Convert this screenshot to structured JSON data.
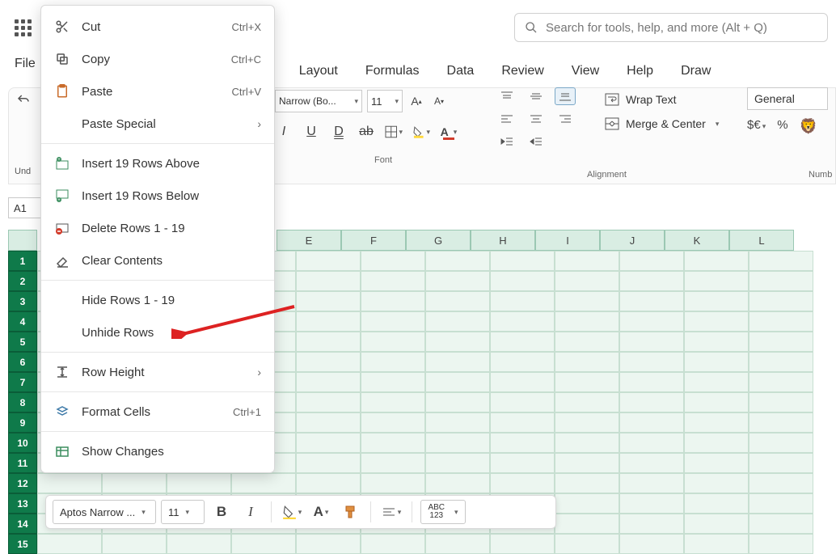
{
  "search": {
    "placeholder": "Search for tools, help, and more (Alt + Q)"
  },
  "menu_tabs": {
    "file": "File",
    "layout": "Layout",
    "formulas": "Formulas",
    "data": "Data",
    "review": "Review",
    "view": "View",
    "help": "Help",
    "draw": "Draw"
  },
  "undo_label": "Und",
  "namebox": "A1",
  "font": {
    "family": "Narrow (Bo...",
    "size": "11",
    "group_label": "Font"
  },
  "align": {
    "group_label": "Alignment"
  },
  "wrap": {
    "wrap_label": "Wrap Text",
    "merge_label": "Merge & Center"
  },
  "number": {
    "format": "General",
    "group_label": "Numb"
  },
  "columns": [
    "E",
    "F",
    "G",
    "H",
    "I",
    "J",
    "K",
    "L"
  ],
  "rows": [
    "1",
    "2",
    "3",
    "4",
    "5",
    "6",
    "7",
    "8",
    "9",
    "10",
    "11",
    "12",
    "13",
    "14",
    "15"
  ],
  "context_menu": {
    "cut": {
      "label": "Cut",
      "shortcut": "Ctrl+X"
    },
    "copy": {
      "label": "Copy",
      "shortcut": "Ctrl+C"
    },
    "paste": {
      "label": "Paste",
      "shortcut": "Ctrl+V"
    },
    "paste_special": {
      "label": "Paste Special"
    },
    "insert_above": {
      "label": "Insert 19 Rows Above"
    },
    "insert_below": {
      "label": "Insert 19 Rows Below"
    },
    "delete_rows": {
      "label": "Delete Rows 1 - 19"
    },
    "clear": {
      "label": "Clear Contents"
    },
    "hide": {
      "label": "Hide Rows 1 - 19"
    },
    "unhide": {
      "label": "Unhide Rows"
    },
    "row_height": {
      "label": "Row Height"
    },
    "format_cells": {
      "label": "Format Cells",
      "shortcut": "Ctrl+1"
    },
    "show_changes": {
      "label": "Show Changes"
    }
  },
  "mini_toolbar": {
    "font": "Aptos Narrow ...",
    "size": "11",
    "abc": "ABC\n123"
  }
}
